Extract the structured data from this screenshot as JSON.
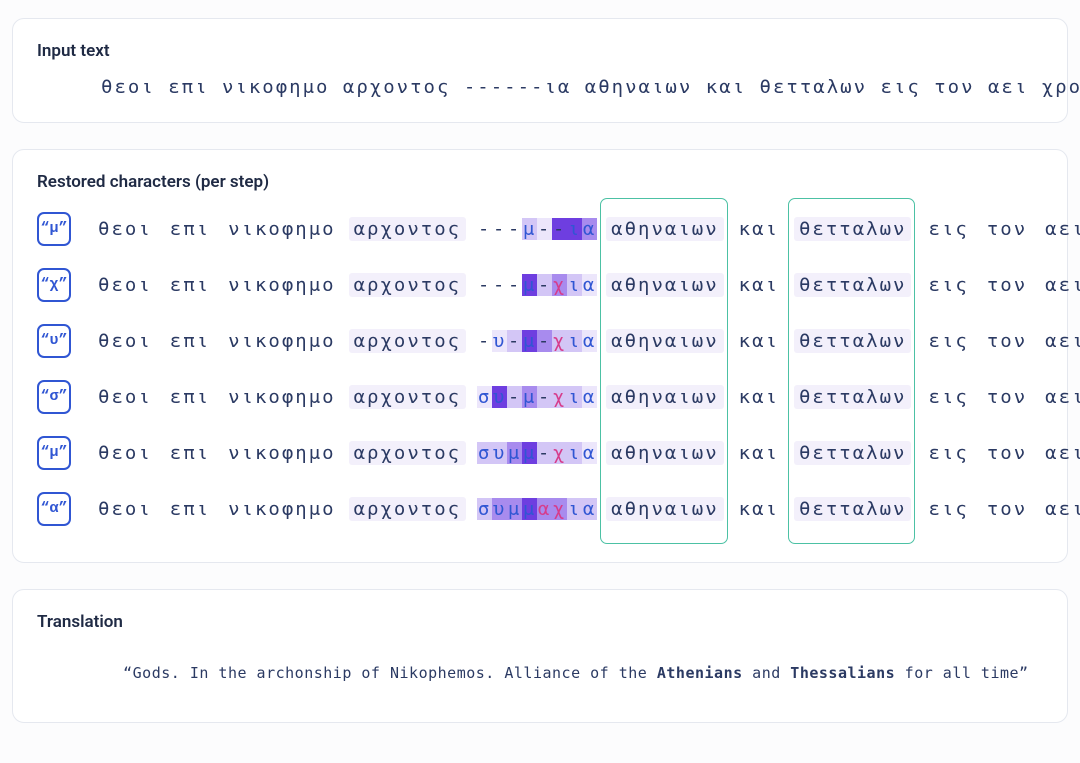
{
  "colors": {
    "shade1": "#ece6fb",
    "shade2": "#d3c6f6",
    "shade3": "#a88bee",
    "shade4": "#6e3ee0"
  },
  "input": {
    "title": "Input text",
    "text": "θεοι επι νικοφημο αρχοντος ------ια αθηναιων και θετταλων εις τον αει χρονον"
  },
  "restored": {
    "title": "Restored characters (per step)",
    "common": {
      "prefix_words": [
        "θεοι",
        "επι",
        "νικοφημο",
        "αρχοντος"
      ],
      "box_word_1": "αθηναιων",
      "mid_word": "και",
      "box_word_2": "θετταλων",
      "suffix_words": [
        "εις",
        "τον",
        "αει",
        "χρονον"
      ]
    },
    "steps": [
      {
        "badge": "μ",
        "slot": [
          {
            "ch": "-",
            "cls": "char-dash",
            "shade": 0
          },
          {
            "ch": "-",
            "cls": "char-dash",
            "shade": 0
          },
          {
            "ch": "-",
            "cls": "char-dash",
            "shade": 0
          },
          {
            "ch": "μ",
            "cls": "char-blue",
            "shade": 2
          },
          {
            "ch": "-",
            "cls": "char-dash",
            "shade": 1
          },
          {
            "ch": "-",
            "cls": "char-dash",
            "shade": 4
          },
          {
            "ch": "ι",
            "cls": "char-blue",
            "shade": 4
          },
          {
            "ch": "α",
            "cls": "char-blue",
            "shade": 3
          }
        ],
        "prefix_shades": [
          0,
          0,
          0,
          1
        ],
        "box1_shade": 1,
        "mid_shade": 0,
        "box2_shade": 1,
        "suffix_shades": [
          0,
          0,
          0,
          0
        ]
      },
      {
        "badge": "χ",
        "slot": [
          {
            "ch": "-",
            "cls": "char-dash",
            "shade": 0
          },
          {
            "ch": "-",
            "cls": "char-dash",
            "shade": 0
          },
          {
            "ch": "-",
            "cls": "char-dash",
            "shade": 0
          },
          {
            "ch": "μ",
            "cls": "char-blue",
            "shade": 4
          },
          {
            "ch": "-",
            "cls": "char-dash",
            "shade": 2
          },
          {
            "ch": "χ",
            "cls": "char-pink",
            "shade": 3
          },
          {
            "ch": "ι",
            "cls": "char-blue",
            "shade": 2
          },
          {
            "ch": "α",
            "cls": "char-blue",
            "shade": 1
          }
        ],
        "prefix_shades": [
          0,
          0,
          0,
          1
        ],
        "box1_shade": 1,
        "mid_shade": 0,
        "box2_shade": 1,
        "suffix_shades": [
          0,
          0,
          0,
          0
        ]
      },
      {
        "badge": "υ",
        "slot": [
          {
            "ch": "-",
            "cls": "char-dash",
            "shade": 0
          },
          {
            "ch": "υ",
            "cls": "char-blue",
            "shade": 1
          },
          {
            "ch": "-",
            "cls": "char-dash",
            "shade": 2
          },
          {
            "ch": "μ",
            "cls": "char-blue",
            "shade": 4
          },
          {
            "ch": "-",
            "cls": "char-dash",
            "shade": 3
          },
          {
            "ch": "χ",
            "cls": "char-pink",
            "shade": 2
          },
          {
            "ch": "ι",
            "cls": "char-blue",
            "shade": 2
          },
          {
            "ch": "α",
            "cls": "char-blue",
            "shade": 1
          }
        ],
        "prefix_shades": [
          0,
          0,
          0,
          1
        ],
        "box1_shade": 1,
        "mid_shade": 0,
        "box2_shade": 1,
        "suffix_shades": [
          0,
          0,
          0,
          0
        ]
      },
      {
        "badge": "σ",
        "slot": [
          {
            "ch": "σ",
            "cls": "char-blue",
            "shade": 1
          },
          {
            "ch": "υ",
            "cls": "char-blue",
            "shade": 4
          },
          {
            "ch": "-",
            "cls": "char-dash",
            "shade": 2
          },
          {
            "ch": "μ",
            "cls": "char-blue",
            "shade": 3
          },
          {
            "ch": "-",
            "cls": "char-dash",
            "shade": 2
          },
          {
            "ch": "χ",
            "cls": "char-pink",
            "shade": 2
          },
          {
            "ch": "ι",
            "cls": "char-blue",
            "shade": 2
          },
          {
            "ch": "α",
            "cls": "char-blue",
            "shade": 1
          }
        ],
        "prefix_shades": [
          0,
          0,
          0,
          1
        ],
        "box1_shade": 1,
        "mid_shade": 0,
        "box2_shade": 1,
        "suffix_shades": [
          0,
          0,
          0,
          0
        ]
      },
      {
        "badge": "μ",
        "slot": [
          {
            "ch": "σ",
            "cls": "char-blue",
            "shade": 2
          },
          {
            "ch": "υ",
            "cls": "char-blue",
            "shade": 2
          },
          {
            "ch": "μ",
            "cls": "char-blue",
            "shade": 3
          },
          {
            "ch": "μ",
            "cls": "char-blue",
            "shade": 4
          },
          {
            "ch": "-",
            "cls": "char-dash",
            "shade": 2
          },
          {
            "ch": "χ",
            "cls": "char-pink",
            "shade": 2
          },
          {
            "ch": "ι",
            "cls": "char-blue",
            "shade": 2
          },
          {
            "ch": "α",
            "cls": "char-blue",
            "shade": 1
          }
        ],
        "prefix_shades": [
          0,
          0,
          0,
          1
        ],
        "box1_shade": 1,
        "mid_shade": 0,
        "box2_shade": 1,
        "suffix_shades": [
          0,
          0,
          0,
          0
        ]
      },
      {
        "badge": "α",
        "slot": [
          {
            "ch": "σ",
            "cls": "char-blue",
            "shade": 2
          },
          {
            "ch": "υ",
            "cls": "char-blue",
            "shade": 3
          },
          {
            "ch": "μ",
            "cls": "char-blue",
            "shade": 3
          },
          {
            "ch": "μ",
            "cls": "char-blue",
            "shade": 4
          },
          {
            "ch": "α",
            "cls": "char-pink",
            "shade": 3
          },
          {
            "ch": "χ",
            "cls": "char-pink",
            "shade": 3
          },
          {
            "ch": "ι",
            "cls": "char-blue",
            "shade": 2
          },
          {
            "ch": "α",
            "cls": "char-blue",
            "shade": 2
          }
        ],
        "prefix_shades": [
          0,
          0,
          0,
          1
        ],
        "box1_shade": 1,
        "mid_shade": 0,
        "box2_shade": 1,
        "suffix_shades": [
          0,
          0,
          0,
          0
        ]
      }
    ]
  },
  "translation": {
    "title": "Translation",
    "prefix": "“Gods. In the archonship of Nikophemos. Alliance of the ",
    "bold1": "Athenians",
    "mid": " and ",
    "bold2": "Thessalians",
    "suffix": " for all time”"
  }
}
